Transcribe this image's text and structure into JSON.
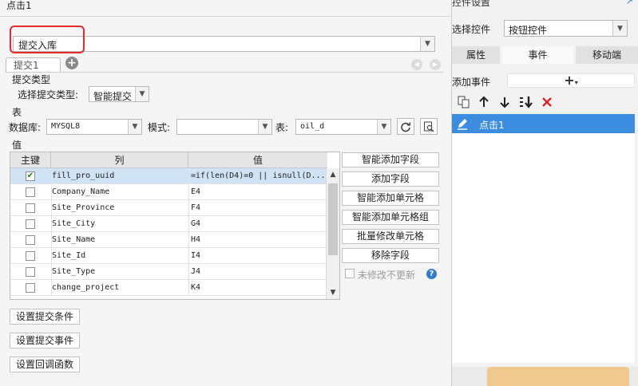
{
  "dialog": {
    "title": "点击1",
    "submit_type_value": "提交入库",
    "tab_label": "提交1",
    "section_submit_type": "提交类型",
    "choose_submit_type_label": "选择提交类型:",
    "choose_submit_type_value": "智能提交",
    "section_table": "表",
    "db_label": "数据库:",
    "db_value": "MYSQL8",
    "schema_label": "模式:",
    "schema_value": "",
    "table_label": "表:",
    "table_value": "oil_d",
    "section_value": "值",
    "grid": {
      "headers": [
        "主键",
        "列",
        "值"
      ],
      "rows": [
        {
          "checked": true,
          "column": "fill_pro_uuid",
          "value": "=if(len(D4)=0 || isnull(D..."
        },
        {
          "checked": false,
          "column": "Company_Name",
          "value": "E4"
        },
        {
          "checked": false,
          "column": "Site_Province",
          "value": "F4"
        },
        {
          "checked": false,
          "column": "Site_City",
          "value": "G4"
        },
        {
          "checked": false,
          "column": "Site_Name",
          "value": "H4"
        },
        {
          "checked": false,
          "column": "Site_Id",
          "value": "I4"
        },
        {
          "checked": false,
          "column": "Site_Type",
          "value": "J4"
        },
        {
          "checked": false,
          "column": "change_project",
          "value": "K4"
        }
      ]
    },
    "side_buttons": [
      "智能添加字段",
      "添加字段",
      "智能添加单元格",
      "智能添加单元格组",
      "批量修改单元格",
      "移除字段"
    ],
    "no_update_label": "未修改不更新",
    "footer_buttons": [
      "设置提交条件",
      "设置提交事件",
      "设置回调函数"
    ]
  },
  "panel": {
    "title": "控件设置",
    "choose_control_label": "选择控件",
    "choose_control_value": "按钮控件",
    "tabs": [
      "属性",
      "事件",
      "移动端"
    ],
    "active_tab": "事件",
    "add_event_label": "添加事件",
    "add_symbol": "+",
    "event_item": "点击1"
  },
  "colors": {
    "highlight_red": "#e62b2b",
    "selected_blue": "#3c8de0",
    "delete_red": "#e02020",
    "help_blue": "#2f7ad0"
  }
}
